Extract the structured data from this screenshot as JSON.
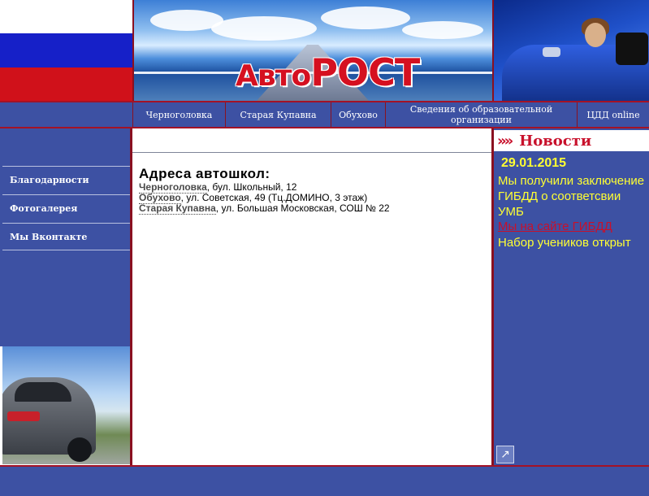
{
  "header": {
    "logo_main": "Авто",
    "logo_accent": "РОСТ"
  },
  "nav": {
    "items": [
      {
        "label": "Черноголовка"
      },
      {
        "label": "Старая Купавна"
      },
      {
        "label": "Обухово"
      },
      {
        "label": "Сведения об образовательной организации"
      },
      {
        "label": "ЦДД online"
      }
    ]
  },
  "sidebar": {
    "items": [
      {
        "label": "Благодарности"
      },
      {
        "label": "Фотогалерея"
      },
      {
        "label": "Мы Вконтакте"
      }
    ]
  },
  "main": {
    "heading": "Адреса автошкол:",
    "addresses": [
      {
        "link": "Черноголовка",
        "text": ", бул. Школьный, 12"
      },
      {
        "link": "Обухово",
        "text": ", ул. Советская, 49 (Тц.ДОМИНО, 3 этаж)"
      },
      {
        "link": "Старая Купавна",
        "text": ", ул. Большая Московская, СОШ № 22"
      }
    ]
  },
  "news": {
    "arrows": "»»",
    "title": "Новости",
    "date": "29.01.2015",
    "text": "Мы получили заключение ГИБДД о соответсвии УМБ",
    "link": "Мы на сайте ГИБДД",
    "text2": "Набор учеников открыт",
    "expand_icon": "↗"
  },
  "colors": {
    "nav_bg": "#3d51a3",
    "rule": "#a31226",
    "news_text": "#ffff33",
    "news_title": "#c8102b"
  }
}
